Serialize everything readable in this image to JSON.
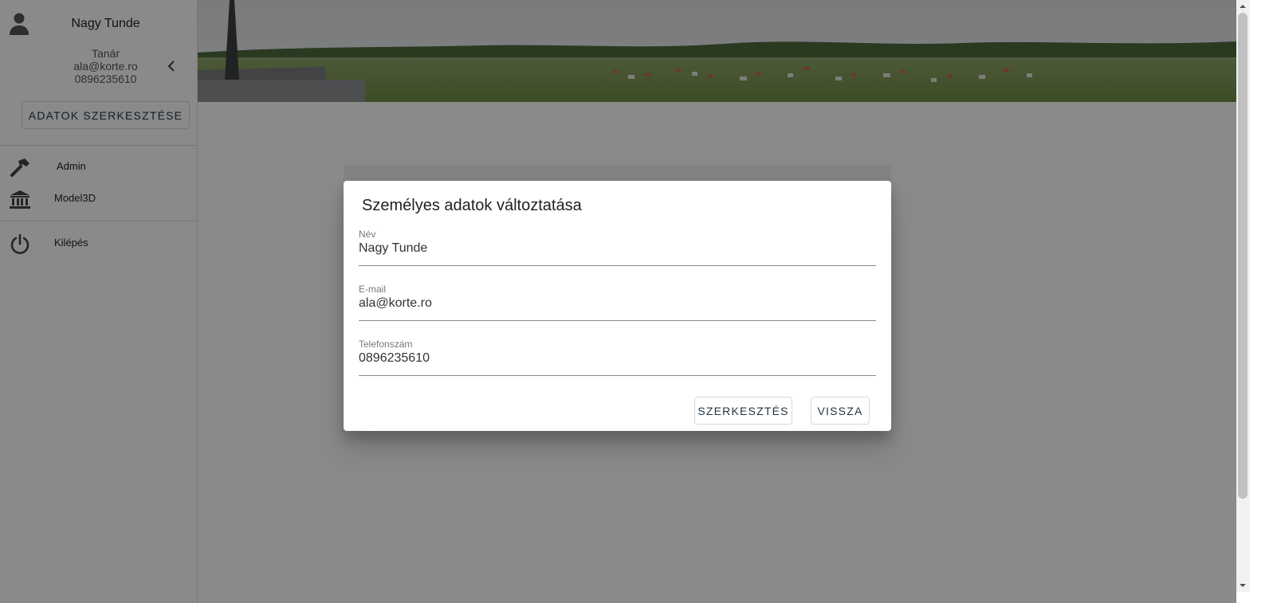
{
  "user": {
    "name": "Nagy Tunde",
    "role": "Tanár",
    "email": "ala@korte.ro",
    "phone": "0896235610",
    "edit_button_label": "ADATOK SZERKESZTÉSE"
  },
  "nav": {
    "items": [
      {
        "label": "Admin",
        "icon": "hammer-icon"
      },
      {
        "label": "Model3D",
        "icon": "bank-icon"
      },
      {
        "label": "Kilépés",
        "icon": "power-icon"
      }
    ]
  },
  "dialog": {
    "title": "Személyes adatok változtatása",
    "fields": [
      {
        "label": "Név",
        "value": "Nagy Tunde"
      },
      {
        "label": "E-mail",
        "value": "ala@korte.ro"
      },
      {
        "label": "Telefonszám",
        "value": "0896235610"
      }
    ],
    "edit_button_label": "SZERKESZTÉS",
    "back_button_label": "VISSZA"
  },
  "colors": {
    "button_text": "#1f3344",
    "overlay": "rgba(0,0,0,0.46)"
  }
}
